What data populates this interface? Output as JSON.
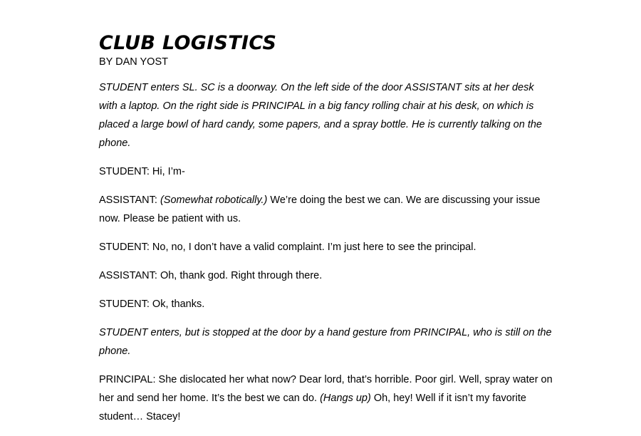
{
  "document": {
    "title": "CLUB LOGISTICS",
    "byline": "BY DAN YOST",
    "p1": "STUDENT enters SL. SC is a doorway. On the left side of the door ASSISTANT sits at her desk with a laptop. On the right side is PRINCIPAL in a big fancy rolling chair at his desk, on which is placed a large bowl of hard candy, some papers, and a spray bottle. He is currently talking on the phone.",
    "p2": "STUDENT: Hi, I’m-",
    "p3_speaker": "ASSISTANT: ",
    "p3_direction": "(Somewhat robotically.)",
    "p3_text": " We’re doing the best we can. We are discussing your issue now. Please be patient with us.",
    "p4": "STUDENT: No, no, I don’t have a valid complaint. I’m just here to see the principal.",
    "p5": "ASSISTANT: Oh, thank god. Right through there.",
    "p6": "STUDENT: Ok, thanks.",
    "p7": "STUDENT enters, but is stopped at the door by a hand gesture from PRINCIPAL, who is still on the phone.",
    "p8_text1": "PRINCIPAL: She dislocated her what now? Dear lord, that’s horrible. Poor girl. Well, spray water on her and send her home. It’s the best we can do. ",
    "p8_direction": "(Hangs up)",
    "p8_text2": " Oh, hey! Well if it isn’t my favorite student… Stacey!"
  }
}
